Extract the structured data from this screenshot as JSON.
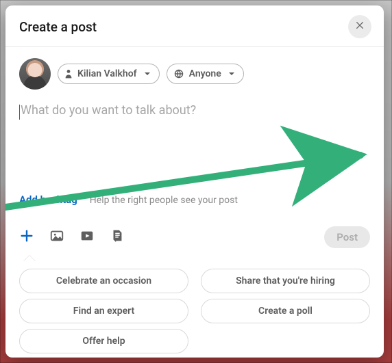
{
  "header": {
    "title": "Create a post"
  },
  "author": {
    "name": "Kilian Valkhof",
    "audience": "Anyone"
  },
  "composer": {
    "placeholder": "What do you want to talk about?"
  },
  "hashtag": {
    "add_label": "Add hashtag",
    "hint": "Help the right people see your post"
  },
  "icons": {
    "plus": "plus-icon",
    "image": "image-icon",
    "video": "video-icon",
    "document": "document-icon"
  },
  "post_button": {
    "label": "Post"
  },
  "suggestions": [
    "Celebrate an occasion",
    "Share that you're hiring",
    "Find an expert",
    "Create a poll",
    "Offer help"
  ]
}
